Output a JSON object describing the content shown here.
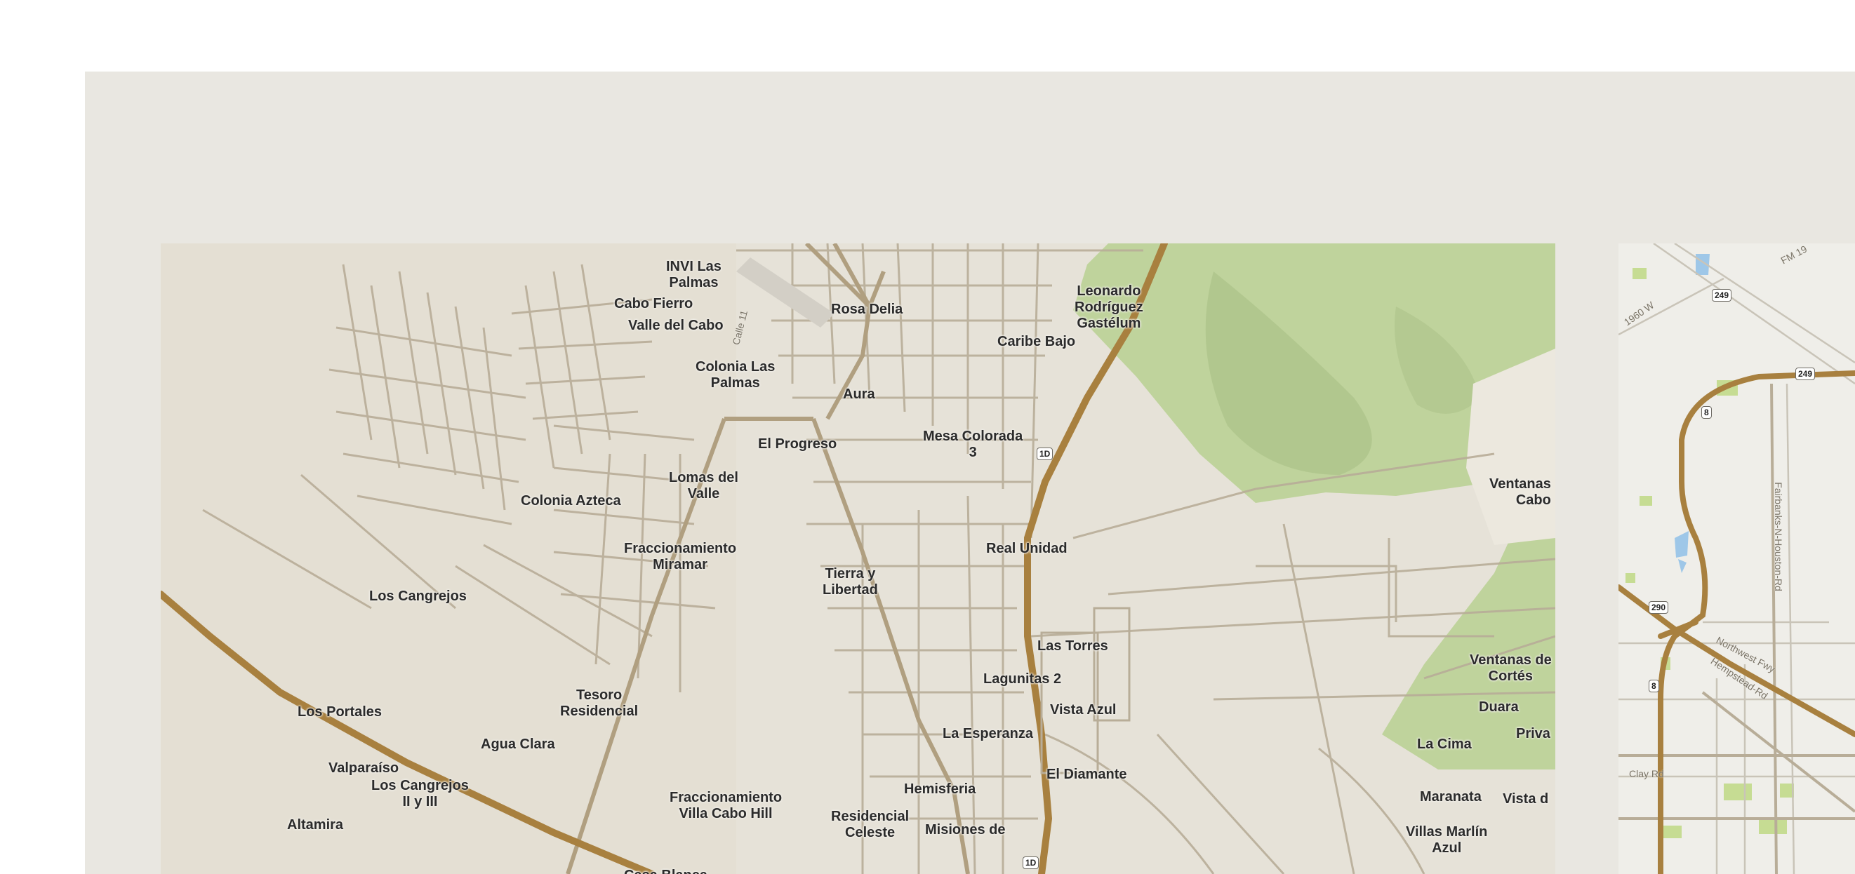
{
  "map": {
    "places": [
      {
        "id": "invi-las-palmas",
        "text": "INVI Las\nPalmas"
      },
      {
        "id": "cabo-fierro",
        "text": "Cabo Fierro"
      },
      {
        "id": "valle-del-cabo",
        "text": "Valle del Cabo"
      },
      {
        "id": "rosa-delia",
        "text": "Rosa Delia"
      },
      {
        "id": "leonardo",
        "text": "Leonardo\nRodríguez\nGastélum"
      },
      {
        "id": "caribe-bajo",
        "text": "Caribe Bajo"
      },
      {
        "id": "colonia-las-palmas",
        "text": "Colonia Las\nPalmas"
      },
      {
        "id": "aura",
        "text": "Aura"
      },
      {
        "id": "el-progreso",
        "text": "El Progreso"
      },
      {
        "id": "mesa-colorada",
        "text": "Mesa Colorada\n3"
      },
      {
        "id": "lomas-del-valle",
        "text": "Lomas del\nValle"
      },
      {
        "id": "colonia-azteca",
        "text": "Colonia Azteca"
      },
      {
        "id": "fracc-miramar",
        "text": "Fraccionamiento\nMiramar"
      },
      {
        "id": "real-unidad",
        "text": "Real Unidad"
      },
      {
        "id": "tierra-y-libertad",
        "text": "Tierra y\nLibertad"
      },
      {
        "id": "los-cangrejos",
        "text": "Los Cangrejos"
      },
      {
        "id": "las-torres",
        "text": "Las Torres"
      },
      {
        "id": "lagunitas-2",
        "text": "Lagunitas 2"
      },
      {
        "id": "tesoro-residencial",
        "text": "Tesoro\nResidencial"
      },
      {
        "id": "los-portales",
        "text": "Los Portales"
      },
      {
        "id": "vista-azul",
        "text": "Vista Azul"
      },
      {
        "id": "agua-clara",
        "text": "Agua Clara"
      },
      {
        "id": "la-esperanza",
        "text": "La Esperanza"
      },
      {
        "id": "valparaiso",
        "text": "Valparaíso"
      },
      {
        "id": "el-diamante",
        "text": "El Diamante"
      },
      {
        "id": "los-cangrejos-2",
        "text": "Los Cangrejos\nII y III"
      },
      {
        "id": "hemisferia",
        "text": "Hemisferia"
      },
      {
        "id": "fracc-villa-cabo-hill",
        "text": "Fraccionamiento\nVilla Cabo Hill"
      },
      {
        "id": "altamira",
        "text": "Altamira"
      },
      {
        "id": "residencial-celeste",
        "text": "Residencial\nCeleste"
      },
      {
        "id": "misiones-de",
        "text": "Misiones de"
      },
      {
        "id": "casa-blanca",
        "text": "Casa Blanca"
      },
      {
        "id": "ventanas-cabo",
        "text": "Ventanas\nCabo"
      },
      {
        "id": "ventanas-cortes",
        "text": "Ventanas de\nCortés"
      },
      {
        "id": "duara",
        "text": "Duara"
      },
      {
        "id": "la-cima",
        "text": "La Cima"
      },
      {
        "id": "priva",
        "text": "Priva"
      },
      {
        "id": "maranata",
        "text": "Maranata"
      },
      {
        "id": "vista-d",
        "text": "Vista d"
      },
      {
        "id": "villas-marlin-azul",
        "text": "Villas Marlín\nAzul"
      }
    ],
    "road_labels": [
      {
        "id": "calle-11",
        "text": "Calle 11"
      },
      {
        "id": "fm-19",
        "text": "FM 19"
      },
      {
        "id": "1960-w",
        "text": "1960 W"
      },
      {
        "id": "fairbanks",
        "text": "Fairbanks-N-Houston-Rd"
      },
      {
        "id": "northwest-fwy",
        "text": "Northwest Fwy"
      },
      {
        "id": "hempstead-rd",
        "text": "Hempstead-Rd"
      },
      {
        "id": "clay-rd",
        "text": "Clay Rd"
      }
    ],
    "shields": [
      {
        "id": "1d-top",
        "text": "1D"
      },
      {
        "id": "1d-bottom",
        "text": "1D"
      },
      {
        "id": "249-a",
        "text": "249"
      },
      {
        "id": "249-b",
        "text": "249"
      },
      {
        "id": "8-a",
        "text": "8"
      },
      {
        "id": "290",
        "text": "290"
      },
      {
        "id": "8-b",
        "text": "8"
      }
    ],
    "colors": {
      "background": "#e9e7e1",
      "land": "#e6e2d8",
      "park": "#b9cf95",
      "major_road": "#a8803f",
      "minor_road": "#b8ad98",
      "water": "#9ec7e8"
    }
  }
}
